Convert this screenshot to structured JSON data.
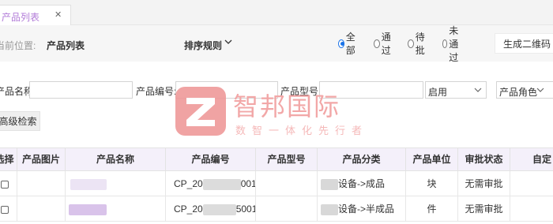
{
  "tabs": [
    {
      "label": "产品列表",
      "close": "✕"
    }
  ],
  "breadcrumb": {
    "prefix": "当前位置:",
    "current": "产品列表"
  },
  "sort": {
    "label": "排序规则",
    "icon": "chevron-down-icon"
  },
  "status_filter": {
    "options": [
      {
        "label": "全部",
        "checked": true
      },
      {
        "label": "通过",
        "checked": false
      },
      {
        "label": "待批",
        "checked": false
      },
      {
        "label": "未通过",
        "checked": false
      }
    ]
  },
  "qr_button": "生成二维码",
  "filters": {
    "name_label": "产品名称:",
    "code_label": "产品编号:",
    "model_label": "产品型号:",
    "status_select": "启用",
    "role_select": "产品角色",
    "advanced_button": "高级检索"
  },
  "watermark": {
    "title": "智邦国际",
    "subtitle": "数智一体化先行者"
  },
  "table": {
    "headers": [
      "选择",
      "产品图片",
      "产品名称",
      "产品编号",
      "产品型号",
      "产品分类",
      "产品单位",
      "审批状态",
      "自定义"
    ],
    "rows": [
      {
        "code_prefix": "CP_20",
        "code_suffix": "001",
        "category": "设备->成品",
        "unit": "块",
        "status": "无需审批"
      },
      {
        "code_prefix": "CP_20",
        "code_suffix": "5001",
        "category": "设备->半成品",
        "unit": "件",
        "status": "无需审批"
      }
    ]
  },
  "colors": {
    "accent": "#b27bd8",
    "radio": "#1a73e8",
    "header_bg": "#f4f0fa",
    "watermark": "#ef9a9a"
  }
}
